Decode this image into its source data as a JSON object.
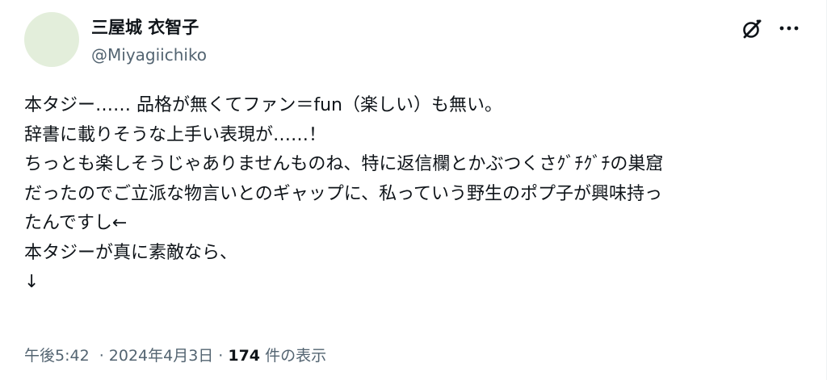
{
  "author": {
    "display_name": "三屋城 衣智子",
    "handle": "@Miyagiichiko",
    "avatar_color": "#e3eedb"
  },
  "actions": {
    "grok_icon": "grok-icon",
    "more_icon": "more-icon"
  },
  "tweet": {
    "lines": [
      "本タジー…… 品格が無くてファン＝fun（楽しい）も無い。",
      "辞書に載りそうな上手い表現が……！",
      "ちっとも楽しそうじゃありませんものね、特に返信欄とかぶつくさｸﾞﾁｸﾞﾁの巣窟",
      "だったのでご立派な物言いとのギャップに、私っていう野生のポプ子が興味持っ",
      "たんですし←",
      "本タジーが真に素敵なら、",
      "↓"
    ]
  },
  "meta": {
    "time": "午後5:42",
    "separator": "·",
    "date": "2024年4月3日",
    "views_count": "174",
    "views_label": "件の表示"
  },
  "colors": {
    "text": "#0f1419",
    "secondary": "#536471"
  }
}
